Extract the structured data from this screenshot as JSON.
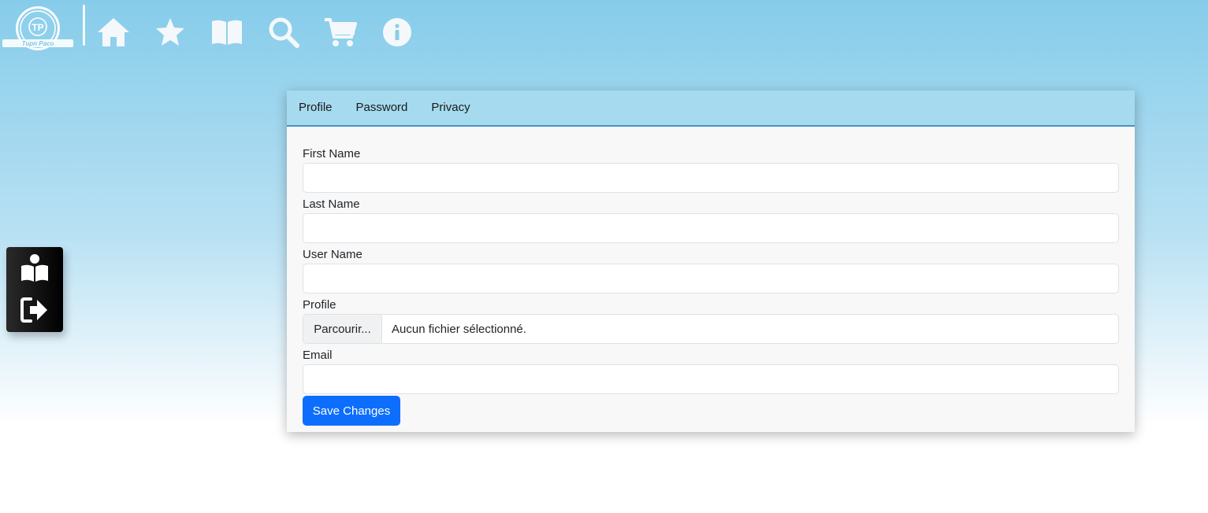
{
  "brand": {
    "logo_text": "TP",
    "logo_subtext": "Tupn Paco"
  },
  "nav": {
    "icons": [
      "home-icon",
      "star-icon",
      "book-icon",
      "search-icon",
      "cart-icon",
      "info-icon"
    ]
  },
  "side_panel": {
    "icons": [
      "reader-icon",
      "logout-icon"
    ]
  },
  "tabs": [
    {
      "label": "Profile"
    },
    {
      "label": "Password"
    },
    {
      "label": "Privacy"
    }
  ],
  "form": {
    "first_name_label": "First Name",
    "first_name_value": "",
    "last_name_label": "Last Name",
    "last_name_value": "",
    "user_name_label": "User Name",
    "user_name_value": "",
    "profile_label": "Profile",
    "file_button": "Parcourir...",
    "file_status": "Aucun fichier sélectionné.",
    "email_label": "Email",
    "email_value": "",
    "save_label": "Save Changes"
  },
  "colors": {
    "accent": "#0d6efd",
    "sky_top": "#86ccea",
    "tab_bar": "#a6daef",
    "icon": "#f4f8fb"
  }
}
